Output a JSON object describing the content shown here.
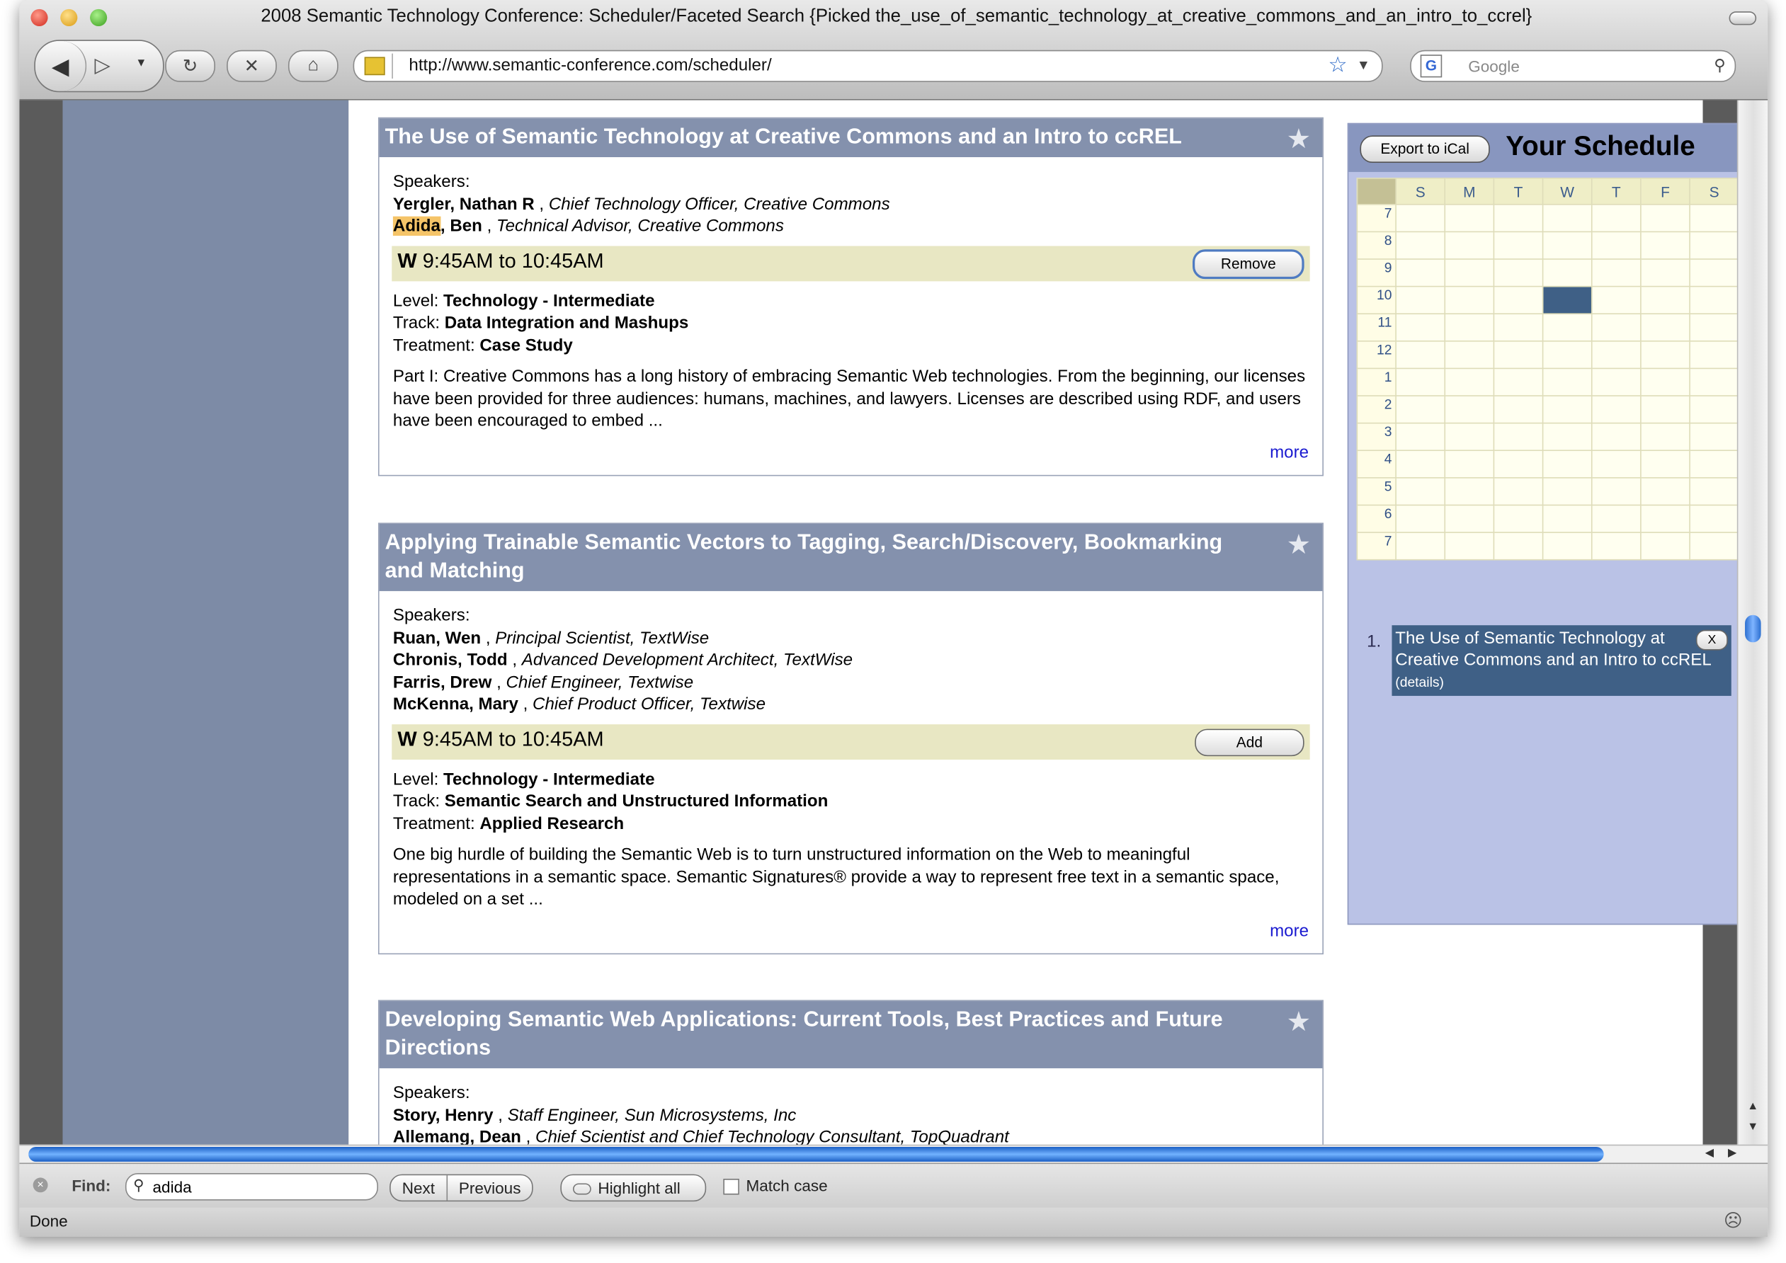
{
  "window": {
    "title": "2008 Semantic Technology Conference: Scheduler/Faceted Search {Picked the_use_of_semantic_technology_at_creative_commons_and_an_intro_to_ccrel}"
  },
  "toolbar": {
    "url": "http://www.semantic-conference.com/scheduler/",
    "search_placeholder": "Google"
  },
  "sessions": [
    {
      "title": "The Use of Semantic Technology at Creative Commons and an Intro to ccREL",
      "speakers_label": "Speakers:",
      "speakers": [
        {
          "name_hl": "",
          "name": "Yergler, Nathan R",
          "role": "Chief Technology Officer, Creative Commons"
        },
        {
          "name_hl": "Adida",
          "name": ", Ben",
          "role": "Technical Advisor, Creative Commons"
        }
      ],
      "day": "W",
      "time": "9:45AM to 10:45AM",
      "button": "Remove",
      "level_label": "Level:",
      "level": "Technology - Intermediate",
      "track_label": "Track:",
      "track": "Data Integration and Mashups",
      "treatment_label": "Treatment:",
      "treatment": "Case Study",
      "description": "Part I: Creative Commons has a long history of embracing Semantic Web technologies. From the beginning, our licenses have been provided for three audiences: humans, machines, and lawyers. Licenses are described using RDF, and users have been encouraged to embed ...",
      "more": "more"
    },
    {
      "title": "Applying Trainable Semantic Vectors to Tagging, Search/Discovery, Bookmarking and Matching",
      "speakers_label": "Speakers:",
      "speakers": [
        {
          "name": "Ruan, Wen",
          "role": "Principal Scientist, TextWise"
        },
        {
          "name": "Chronis, Todd",
          "role": "Advanced Development Architect, TextWise"
        },
        {
          "name": "Farris, Drew",
          "role": "Chief Engineer, Textwise"
        },
        {
          "name": "McKenna, Mary",
          "role": "Chief Product Officer, Textwise"
        }
      ],
      "day": "W",
      "time": "9:45AM to 10:45AM",
      "button": "Add",
      "level_label": "Level:",
      "level": "Technology - Intermediate",
      "track_label": "Track:",
      "track": "Semantic Search and Unstructured Information",
      "treatment_label": "Treatment:",
      "treatment": "Applied Research",
      "description": "One big hurdle of building the Semantic Web is to turn unstructured information on the Web to meaningful representations in a semantic space. Semantic Signatures® provide a way to represent free text in a semantic space, modeled on a set ...",
      "more": "more"
    },
    {
      "title": "Developing Semantic Web Applications: Current Tools, Best Practices and Future Directions",
      "speakers_label": "Speakers:",
      "speakers": [
        {
          "name": "Story, Henry",
          "role": "Staff Engineer, Sun Microsystems, Inc"
        },
        {
          "name": "Allemang, Dean",
          "role": "Chief Scientist and Chief Technology Consultant, TopQuadrant"
        }
      ]
    }
  ],
  "schedule": {
    "export_button": "Export to iCal",
    "title": "Your Schedule",
    "days": [
      "S",
      "M",
      "T",
      "W",
      "T",
      "F",
      "S"
    ],
    "hours": [
      "7",
      "8",
      "9",
      "10",
      "11",
      "12",
      "1",
      "2",
      "3",
      "4",
      "5",
      "6",
      "7"
    ],
    "booked": {
      "day": "W",
      "hour": "10"
    },
    "items": [
      {
        "number": "1.",
        "title": "The Use of Semantic Technology at Creative Commons and an Intro to ccREL",
        "details": "(details)",
        "remove": "X"
      }
    ]
  },
  "findbar": {
    "label": "Find:",
    "query": "adida",
    "next": "Next",
    "previous": "Previous",
    "highlight_all": "Highlight all",
    "match_case": "Match case"
  },
  "status": "Done",
  "colors": {
    "card_header": "#8491ad",
    "time_bar": "#e8e7c3",
    "schedule_panel": "#bac2e6",
    "booked_slot": "#3f6086",
    "link": "#1a1ad0",
    "find_highlight": "#f5c468"
  }
}
